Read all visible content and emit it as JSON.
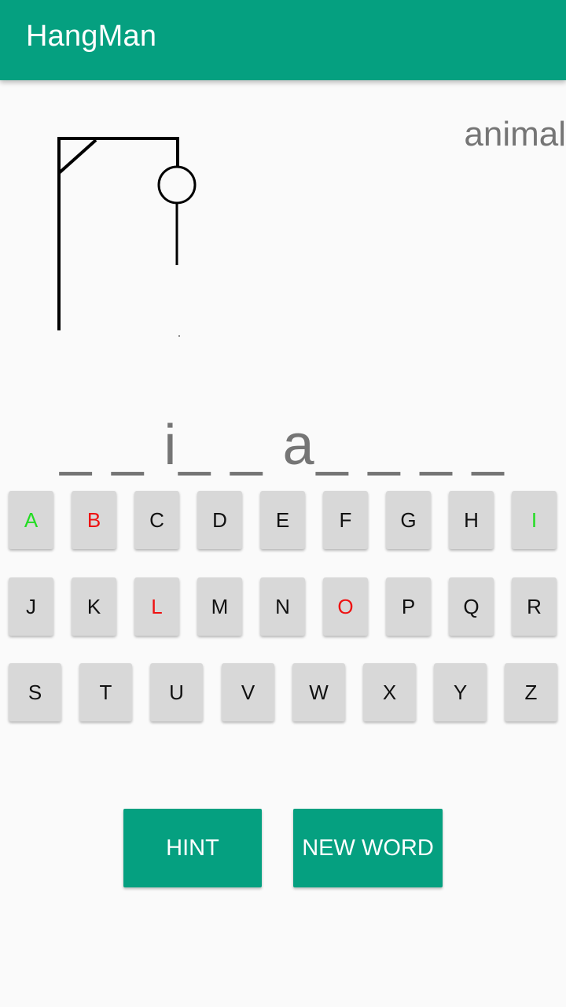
{
  "app_bar": {
    "title": "HangMan"
  },
  "game": {
    "category": "animal",
    "word_display": "_ _ i_ _ a_ _ _ _",
    "wrong_guesses": 3,
    "parts_drawn": [
      "head",
      "body"
    ]
  },
  "keyboard": {
    "rows": [
      [
        {
          "letter": "A",
          "state": "correct"
        },
        {
          "letter": "B",
          "state": "wrong"
        },
        {
          "letter": "C",
          "state": "unused"
        },
        {
          "letter": "D",
          "state": "unused"
        },
        {
          "letter": "E",
          "state": "unused"
        },
        {
          "letter": "F",
          "state": "unused"
        },
        {
          "letter": "G",
          "state": "unused"
        },
        {
          "letter": "H",
          "state": "unused"
        },
        {
          "letter": "I",
          "state": "correct"
        }
      ],
      [
        {
          "letter": "J",
          "state": "unused"
        },
        {
          "letter": "K",
          "state": "unused"
        },
        {
          "letter": "L",
          "state": "wrong"
        },
        {
          "letter": "M",
          "state": "unused"
        },
        {
          "letter": "N",
          "state": "unused"
        },
        {
          "letter": "O",
          "state": "wrong"
        },
        {
          "letter": "P",
          "state": "unused"
        },
        {
          "letter": "Q",
          "state": "unused"
        },
        {
          "letter": "R",
          "state": "unused"
        }
      ],
      [
        {
          "letter": "S",
          "state": "unused"
        },
        {
          "letter": "T",
          "state": "unused"
        },
        {
          "letter": "U",
          "state": "unused"
        },
        {
          "letter": "V",
          "state": "unused"
        },
        {
          "letter": "W",
          "state": "unused"
        },
        {
          "letter": "X",
          "state": "unused"
        },
        {
          "letter": "Y",
          "state": "unused"
        },
        {
          "letter": "Z",
          "state": "unused"
        }
      ]
    ]
  },
  "actions": {
    "hint_label": "HINT",
    "new_word_label": "NEW WORD"
  },
  "colors": {
    "primary": "#05a080",
    "correct_letter": "#22dd22",
    "wrong_letter": "#ee1111",
    "key_background": "#d8d8d8"
  }
}
